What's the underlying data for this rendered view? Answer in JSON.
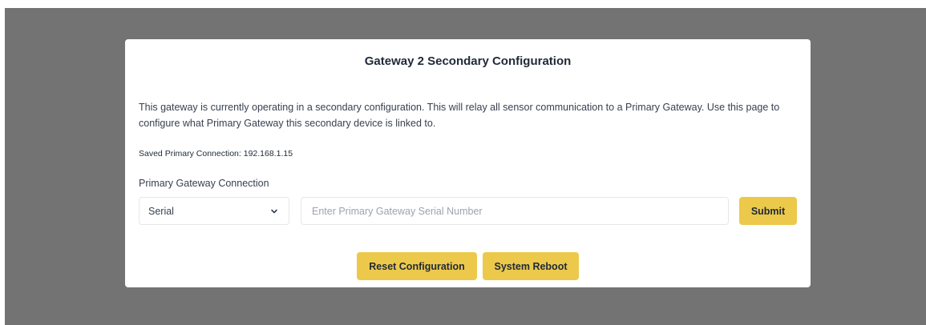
{
  "modal": {
    "title": "Gateway 2 Secondary Configuration",
    "description": "This gateway is currently operating in a secondary configuration. This will relay all sensor communication to a Primary Gateway. Use this page to configure what Primary Gateway this secondary device is linked to.",
    "saved_connection": {
      "label": "Saved Primary Connection:",
      "value": "192.168.1.15"
    }
  },
  "form": {
    "connection_label": "Primary Gateway Connection",
    "connection_type": {
      "selected": "Serial",
      "icon": "chevron-down-icon"
    },
    "serial_input": {
      "value": "",
      "placeholder": "Enter Primary Gateway Serial Number"
    },
    "submit_label": "Submit"
  },
  "actions": {
    "reset_label": "Reset Configuration",
    "reboot_label": "System Reboot"
  },
  "colors": {
    "backdrop": "#737373",
    "accent": "#ecc94b",
    "text": "#1f2937"
  }
}
